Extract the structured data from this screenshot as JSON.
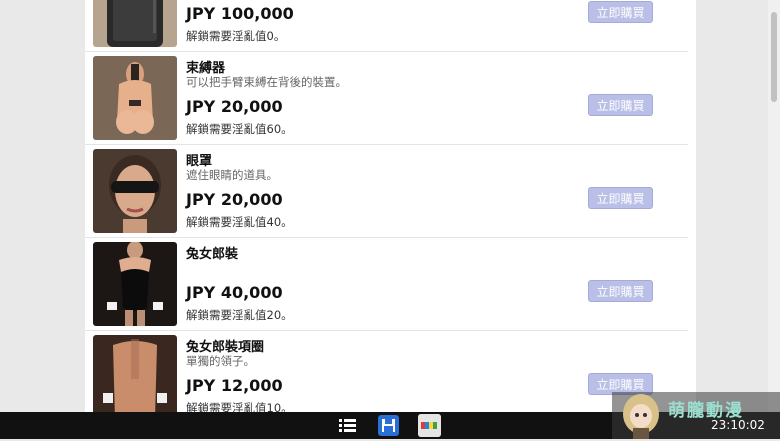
{
  "items": [
    {
      "name": "",
      "desc": "",
      "price": "JPY 100,000",
      "requirement": "解鎖需要淫亂值0。",
      "buy_label": "立即購買"
    },
    {
      "name": "束縛器",
      "desc": "可以把手臂束縛在背後的裝置。",
      "price": "JPY 20,000",
      "requirement": "解鎖需要淫亂值60。",
      "buy_label": "立即購買"
    },
    {
      "name": "眼罩",
      "desc": "遮住眼睛的道具。",
      "price": "JPY 20,000",
      "requirement": "解鎖需要淫亂值40。",
      "buy_label": "立即購買"
    },
    {
      "name": "兔女郎裝",
      "desc": "",
      "price": "JPY 40,000",
      "requirement": "解鎖需要淫亂值20。",
      "buy_label": "立即購買"
    },
    {
      "name": "兔女郎裝項圈",
      "desc": "單獨的領子。",
      "price": "JPY 12,000",
      "requirement": "解鎖需要淫亂值10。",
      "buy_label": "立即購買"
    }
  ],
  "icons": {
    "menu": "list-icon",
    "save": "save-icon",
    "app": "app-icon"
  },
  "watermark": {
    "text": "萌朧動漫"
  },
  "clock": "23:10:02",
  "colors": {
    "buy_button": "#b9bfe6",
    "taskbar": "#111111"
  }
}
